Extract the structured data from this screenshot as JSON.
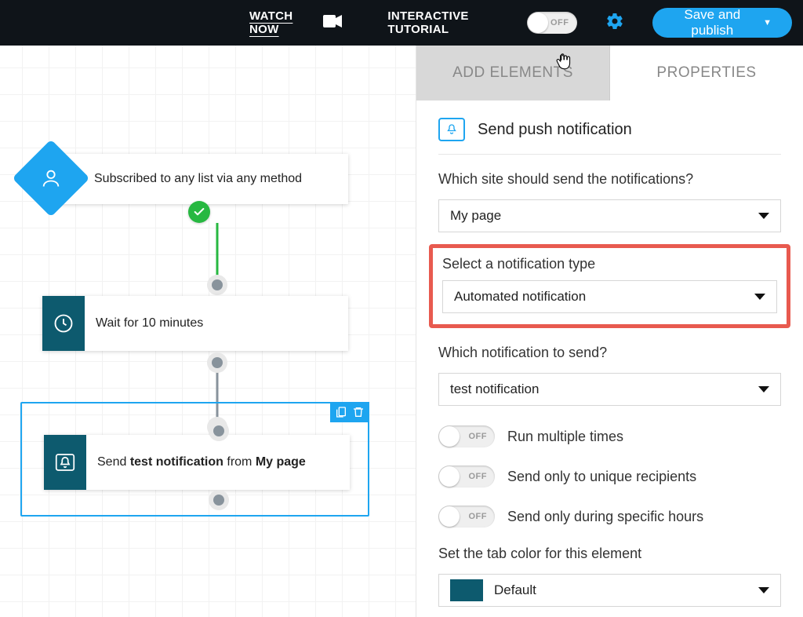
{
  "topbar": {
    "watch_now": "WATCH NOW",
    "tutorial_label": "INTERACTIVE TUTORIAL",
    "tutorial_toggle": "OFF",
    "save_label": "Save and publish"
  },
  "tabs": {
    "add": "ADD ELEMENTS",
    "props": "PROPERTIES"
  },
  "flow": {
    "trigger": "Subscribed to any list via any method",
    "wait": "Wait for 10 minutes",
    "push_prefix": "Send ",
    "push_notif": "test notification",
    "push_mid": " from ",
    "push_page": "My page"
  },
  "panel": {
    "title": "Send push notification",
    "site_label": "Which site should send the notifications?",
    "site_value": "My page",
    "type_label": "Select a notification type",
    "type_value": "Automated notification",
    "which_label": "Which notification to send?",
    "which_value": "test notification",
    "run_multiple": "Run multiple times",
    "unique": "Send only to unique recipients",
    "hours": "Send only during specific hours",
    "tab_color_label": "Set the tab color for this element",
    "tab_color_value": "Default",
    "toggle_off": "OFF"
  }
}
